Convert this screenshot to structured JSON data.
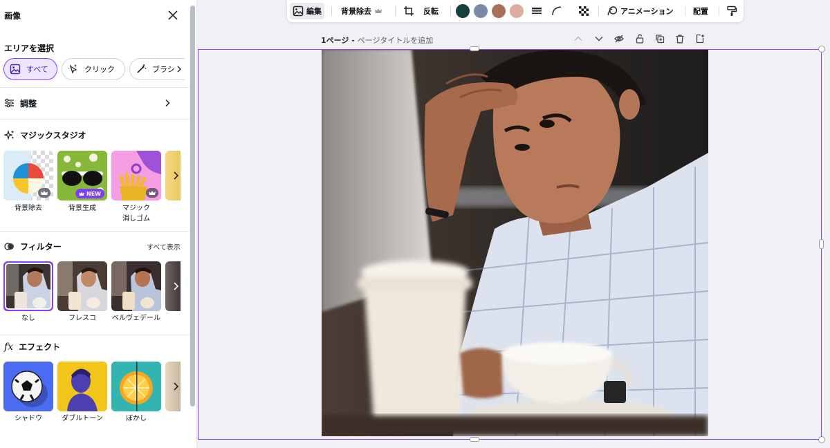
{
  "panel": {
    "title": "画像",
    "area_select": {
      "label": "エリアを選択",
      "options": [
        "すべて",
        "クリック",
        "ブラシ"
      ]
    },
    "adjust": {
      "label": "調整"
    },
    "magic_studio": {
      "label": "マジックスタジオ",
      "items": [
        {
          "label": "背景除去",
          "badge": "crown"
        },
        {
          "label": "背景生成",
          "badge": "NEW"
        },
        {
          "label": "マジック\n消しゴム",
          "badge": "crown"
        }
      ]
    },
    "filters": {
      "label": "フィルター",
      "see_all": "すべて表示",
      "items": [
        "なし",
        "フレスコ",
        "ベルヴェデール"
      ]
    },
    "effects": {
      "label": "エフェクト",
      "items": [
        "シャドウ",
        "ダブルトーン",
        "ぼかし"
      ]
    }
  },
  "toolbar": {
    "edit": "編集",
    "bg_remove": "背景除去",
    "flip": "反転",
    "colors": [
      "#17403a",
      "#7f87ad",
      "#a4715a",
      "#dcaca3"
    ],
    "animate": "アニメーション",
    "position": "配置"
  },
  "page": {
    "number": "1ページ",
    "separator": " - ",
    "title_placeholder": "ページタイトルを追加"
  },
  "colors": {
    "accent": "#8b3dff",
    "active_chip_bg": "#eee6ff"
  }
}
